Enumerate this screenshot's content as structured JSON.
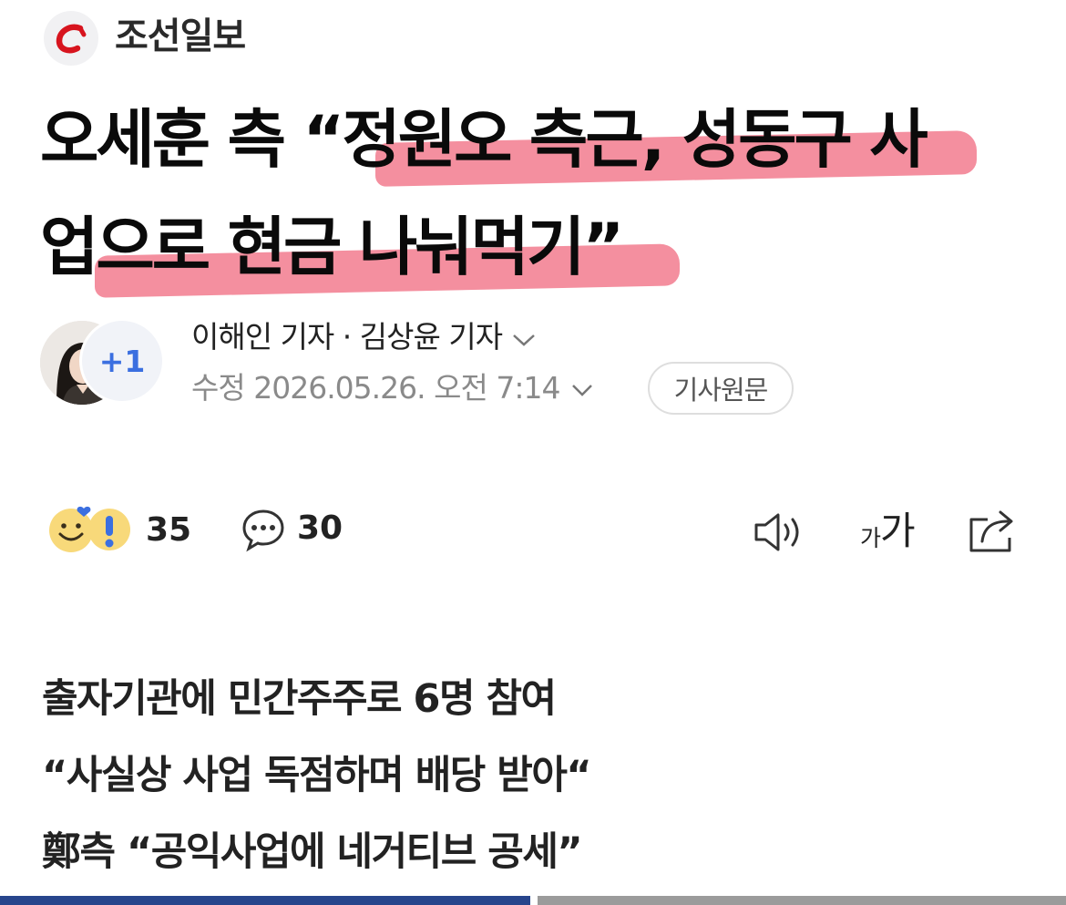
{
  "publisher": {
    "name": "조선일보",
    "logo_icon": "chosun-logo-icon"
  },
  "headline": {
    "line1": "오세훈 측 “정원오 측근, 성동구 사",
    "line2": "업으로 현금 나눠먹기”",
    "highlight_color": "#ee4a64"
  },
  "byline": {
    "authors": "이해인 기자 · 김상윤 기자",
    "extra_authors": "+1",
    "timestamp": "수정 2026.05.26. 오전 7:14",
    "original_button": "기사원문"
  },
  "actions": {
    "reaction_count": "35",
    "comment_count": "30",
    "font_small": "가",
    "font_big": "가"
  },
  "subheads": [
    "출자기관에 민간주주로 6명 참여",
    "“사실상 사업 독점하며 배당 받아“",
    "鄭측 “공익사업에 네거티브 공세”"
  ],
  "colors": {
    "accent_blue": "#3b6fe0",
    "logo_red": "#d7141e"
  }
}
